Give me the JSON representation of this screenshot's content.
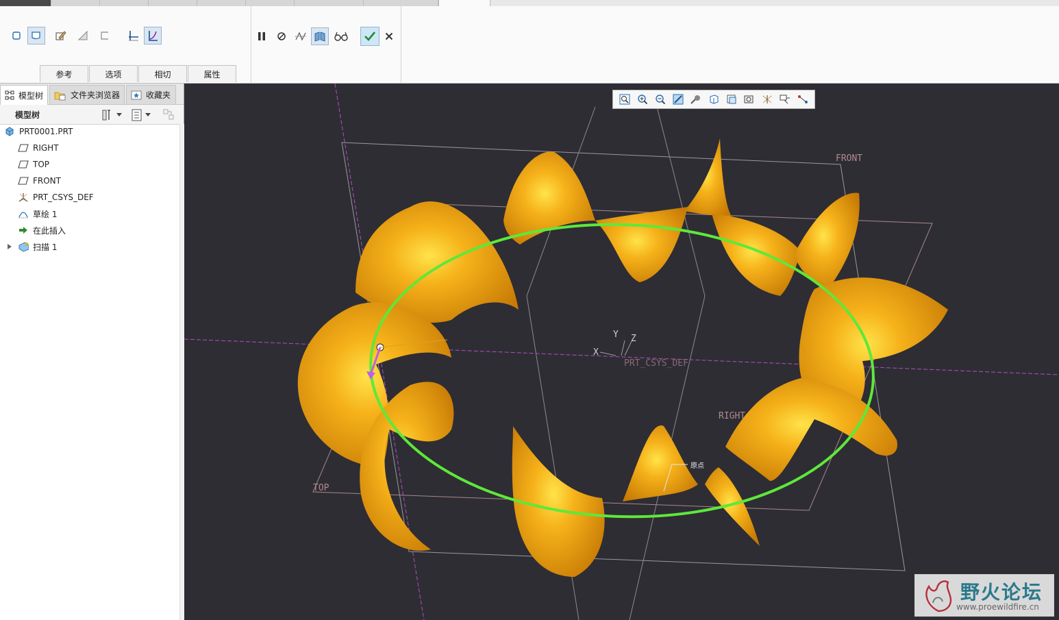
{
  "ribbon": {
    "sub_tabs": [
      "参考",
      "选项",
      "相切",
      "属性"
    ]
  },
  "left_panel": {
    "nav_tabs": [
      {
        "label": "模型树",
        "icon": "model-tree-icon"
      },
      {
        "label": "文件夹浏览器",
        "icon": "folder-browser-icon"
      },
      {
        "label": "收藏夹",
        "icon": "favorites-icon"
      }
    ],
    "tree_header": "模型树",
    "tree_items": [
      {
        "label": "PRT0001.PRT",
        "icon": "part-icon"
      },
      {
        "label": "RIGHT",
        "icon": "datum-plane-icon"
      },
      {
        "label": "TOP",
        "icon": "datum-plane-icon"
      },
      {
        "label": "FRONT",
        "icon": "datum-plane-icon"
      },
      {
        "label": "PRT_CSYS_DEF",
        "icon": "coordinate-system-icon"
      },
      {
        "label": "草绘 1",
        "icon": "sketch-icon"
      },
      {
        "label": "在此插入",
        "icon": "insert-here-arrow-icon"
      },
      {
        "label": "扫描 1",
        "icon": "sweep-feature-icon"
      }
    ]
  },
  "viewport": {
    "labels": {
      "front": "FRONT",
      "right": "RIGHT",
      "top": "TOP",
      "csys": "PRT_CSYS_DEF",
      "axis_x": "X",
      "axis_y": "Y",
      "axis_z": "Z",
      "origin_tag": "原点"
    },
    "colors": {
      "background": "#2e2d34",
      "surface": "#f0a010",
      "trajectory": "#5ee83a"
    }
  },
  "watermark": {
    "title": "野火论坛",
    "url": "www.proewildfire.cn"
  }
}
